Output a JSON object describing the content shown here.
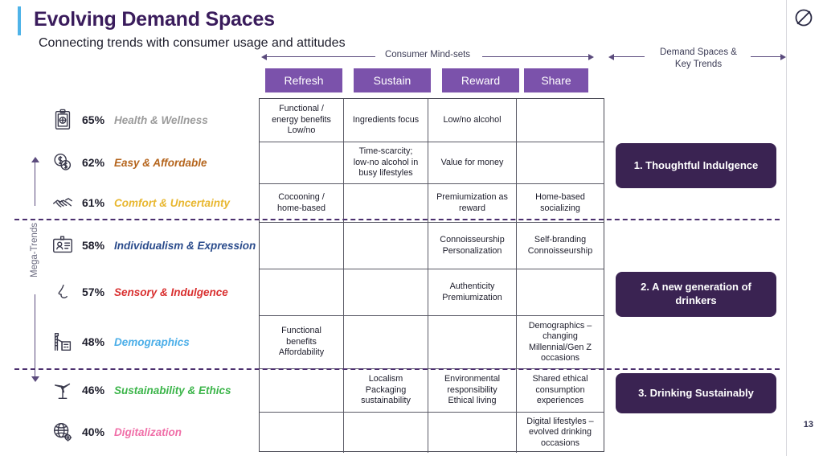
{
  "header": {
    "title": "Evolving Demand Spaces",
    "subtitle": "Connecting trends with consumer usage and attitudes",
    "logo_icon": "circle-slash-logo-icon",
    "page_number": "13",
    "accent_bar_color": "#4FB3E8",
    "title_color": "#3A1C5C"
  },
  "axes": {
    "mindsets_label": "Consumer Mind-sets",
    "demand_label_line1": "Demand Spaces &",
    "demand_label_line2": "Key Trends",
    "mega_trends_label": "Mega-Trends",
    "arrow_color": "#5b4b7d"
  },
  "mindsets": {
    "button_color": "#7B52AB",
    "items": [
      {
        "label": "Refresh"
      },
      {
        "label": "Sustain"
      },
      {
        "label": "Reward"
      },
      {
        "label": "Share"
      }
    ]
  },
  "trends": [
    {
      "pct": "65%",
      "name": "Health & Wellness",
      "color": "#9B9B9B",
      "icon": "clipboard-health-icon"
    },
    {
      "pct": "62%",
      "name": "Easy & Affordable",
      "color": "#B5651D",
      "icon": "coins-money-icon"
    },
    {
      "pct": "61%",
      "name": "Comfort & Uncertainty",
      "color": "#E8B730",
      "icon": "handshake-icon"
    },
    {
      "pct": "58%",
      "name": "Individualism & Expression",
      "color": "#2B4C8C",
      "icon": "id-card-icon"
    },
    {
      "pct": "57%",
      "name": "Sensory & Indulgence",
      "color": "#D93030",
      "icon": "nose-profile-icon"
    },
    {
      "pct": "48%",
      "name": "Demographics",
      "color": "#4BAEE8",
      "icon": "factory-city-icon"
    },
    {
      "pct": "46%",
      "name": "Sustainability & Ethics",
      "color": "#3CB54A",
      "icon": "wind-turbine-icon"
    },
    {
      "pct": "40%",
      "name": "Digitalization",
      "color": "#F06FA8",
      "icon": "globe-gear-icon"
    }
  ],
  "matrix": {
    "columns": [
      "Refresh",
      "Sustain",
      "Reward",
      "Share"
    ],
    "rows": [
      {
        "trend": "Health & Wellness",
        "cells": [
          "Functional /\nenergy benefits\nLow/no",
          "Ingredients focus",
          "Low/no alcohol",
          ""
        ]
      },
      {
        "trend": "Easy & Affordable",
        "cells": [
          "",
          "Time-scarcity;\nlow-no alcohol in\nbusy lifestyles",
          "Value for money",
          ""
        ]
      },
      {
        "trend": "Comfort & Uncertainty",
        "cells": [
          "Cocooning /\nhome-based",
          "",
          "Premiumization as\nreward",
          "Home-based\nsocializing"
        ]
      },
      {
        "trend": "Individualism & Expression",
        "cells": [
          "",
          "",
          "Connoisseurship\nPersonalization",
          "Self-branding\nConnoisseurship"
        ]
      },
      {
        "trend": "Sensory & Indulgence",
        "cells": [
          "",
          "",
          "Authenticity\nPremiumization",
          ""
        ]
      },
      {
        "trend": "Demographics",
        "cells": [
          "Functional\nbenefits\nAffordability",
          "",
          "",
          "Demographics –\nchanging\nMillennial/Gen Z\noccasions"
        ]
      },
      {
        "trend": "Sustainability & Ethics",
        "cells": [
          "",
          "Localism\nPackaging\nsustainability",
          "Environmental\nresponsibility\nEthical living",
          "Shared ethical\nconsumption\nexperiences"
        ]
      },
      {
        "trend": "Digitalization",
        "cells": [
          "",
          "",
          "",
          "Digital lifestyles –\nevolved drinking\noccasions"
        ]
      }
    ]
  },
  "demand_spaces": {
    "box_color": "#3A2352",
    "items": [
      {
        "label": "1. Thoughtful Indulgence"
      },
      {
        "label": "2. A new generation of drinkers"
      },
      {
        "label": "3. Drinking Sustainably"
      }
    ]
  },
  "separators": {
    "color": "#4b2f6e"
  }
}
